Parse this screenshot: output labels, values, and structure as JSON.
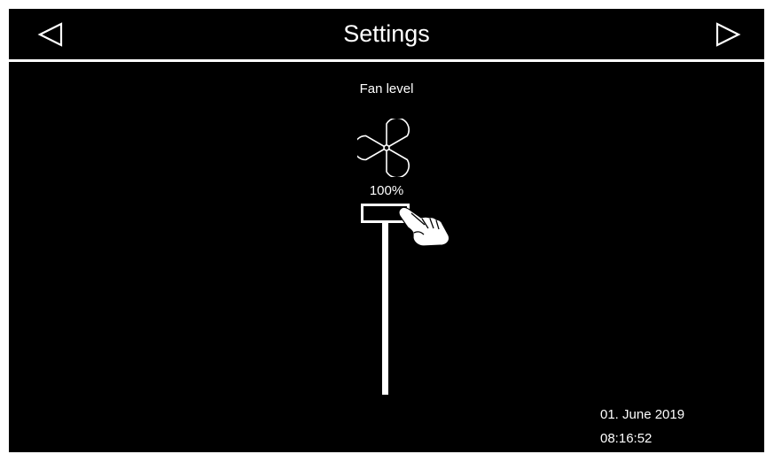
{
  "header": {
    "title": "Settings",
    "prev_icon": "triangle-left-icon",
    "next_icon": "triangle-right-icon"
  },
  "fan": {
    "label": "Fan level",
    "icon": "fan-icon",
    "level_text": "100%",
    "level_fraction": 1.0
  },
  "pointer_icon": "hand-pointer-icon",
  "status": {
    "date": "01. June 2019",
    "time": "08:16:52"
  },
  "colors": {
    "background": "#000000",
    "foreground": "#ffffff"
  }
}
